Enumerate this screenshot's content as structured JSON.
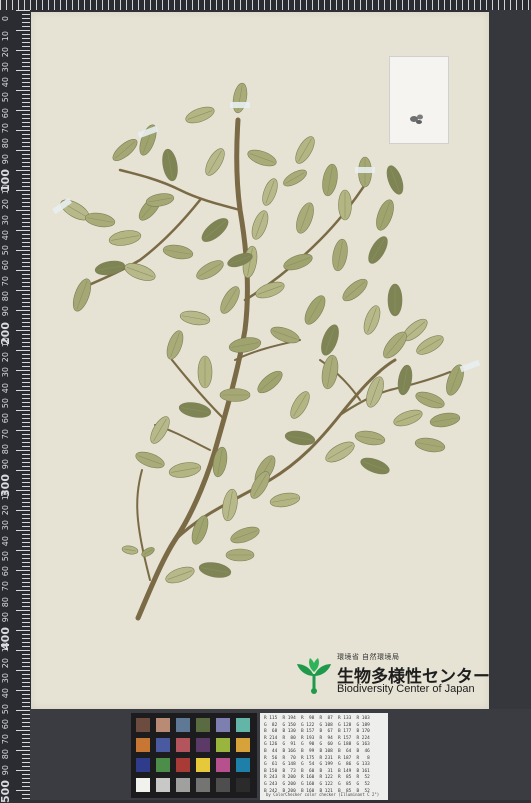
{
  "ruler": {
    "labels": [
      "0",
      "10",
      "20",
      "30",
      "40",
      "50",
      "60",
      "70",
      "80",
      "90",
      "100",
      "10",
      "20",
      "30",
      "40",
      "50",
      "60",
      "70",
      "80",
      "90",
      "200",
      "10",
      "20",
      "30",
      "40",
      "50",
      "60",
      "70",
      "80",
      "90",
      "300",
      "10",
      "20",
      "30",
      "40",
      "50",
      "60",
      "70",
      "80",
      "90",
      "400",
      "10",
      "20",
      "30",
      "40",
      "50",
      "60",
      "70",
      "80",
      "90",
      "500"
    ],
    "major": [
      "100",
      "200",
      "300",
      "400",
      "500"
    ]
  },
  "logo": {
    "ministry": "環境省 自然環境局",
    "name_jp": "生物多様性センター",
    "name_en": "Biodiversity Center of Japan",
    "brand_color": "#1f9a4a"
  },
  "colors": {
    "sheet": "#e6e2d4",
    "leaf": "#a9ac79",
    "leaf_dark": "#7f8454",
    "stem": "#7a6a45",
    "tag": "#e8eef0"
  },
  "color_checker": {
    "swatches": [
      "#6b4c3e",
      "#b98a74",
      "#5e7895",
      "#5a6b41",
      "#7d7fb0",
      "#63b6a7",
      "#c77633",
      "#4a5aa1",
      "#b4545d",
      "#5b3a67",
      "#9ab53e",
      "#d8a23a",
      "#2e3c8b",
      "#4c8e49",
      "#a83b36",
      "#e6c93a",
      "#b6518e",
      "#1e7fa8",
      "#f1f1ee",
      "#c8c8c6",
      "#a0a09f",
      "#747473",
      "#4e4e4e",
      "#2b2b2b"
    ]
  },
  "datacard": {
    "rows": [
      "R 115  R 194  R  98  R  87  R 133  R 103",
      "G  82  G 150  G 122  G 108  G 128  G 189",
      "B  68  B 130  B 157  B  67  B 177  B 170",
      "R 214  R  80  R 193  R  94  R 157  R 224",
      "G 126  G  91  G  90  G  60  G 188  G 163",
      "B  44  B 166  B  99  B 108  B  64  B  46",
      "R  56  R  70  R 175  R 231  R 187  R   8",
      "G  61  G 148  G  54  G 199  G  86  G 133",
      "B 150  B  73  B  60  B  31  B 149  B 161",
      "R 243  R 200  R 160  R 122  R  85  R  52",
      "G 243  G 200  G 160  G 122  G  85  G  52",
      "B 242  B 200  B 160  B 121  B  85  B  52"
    ],
    "footer": "by ColorChecker color checker (Illuminant C 2°)"
  }
}
